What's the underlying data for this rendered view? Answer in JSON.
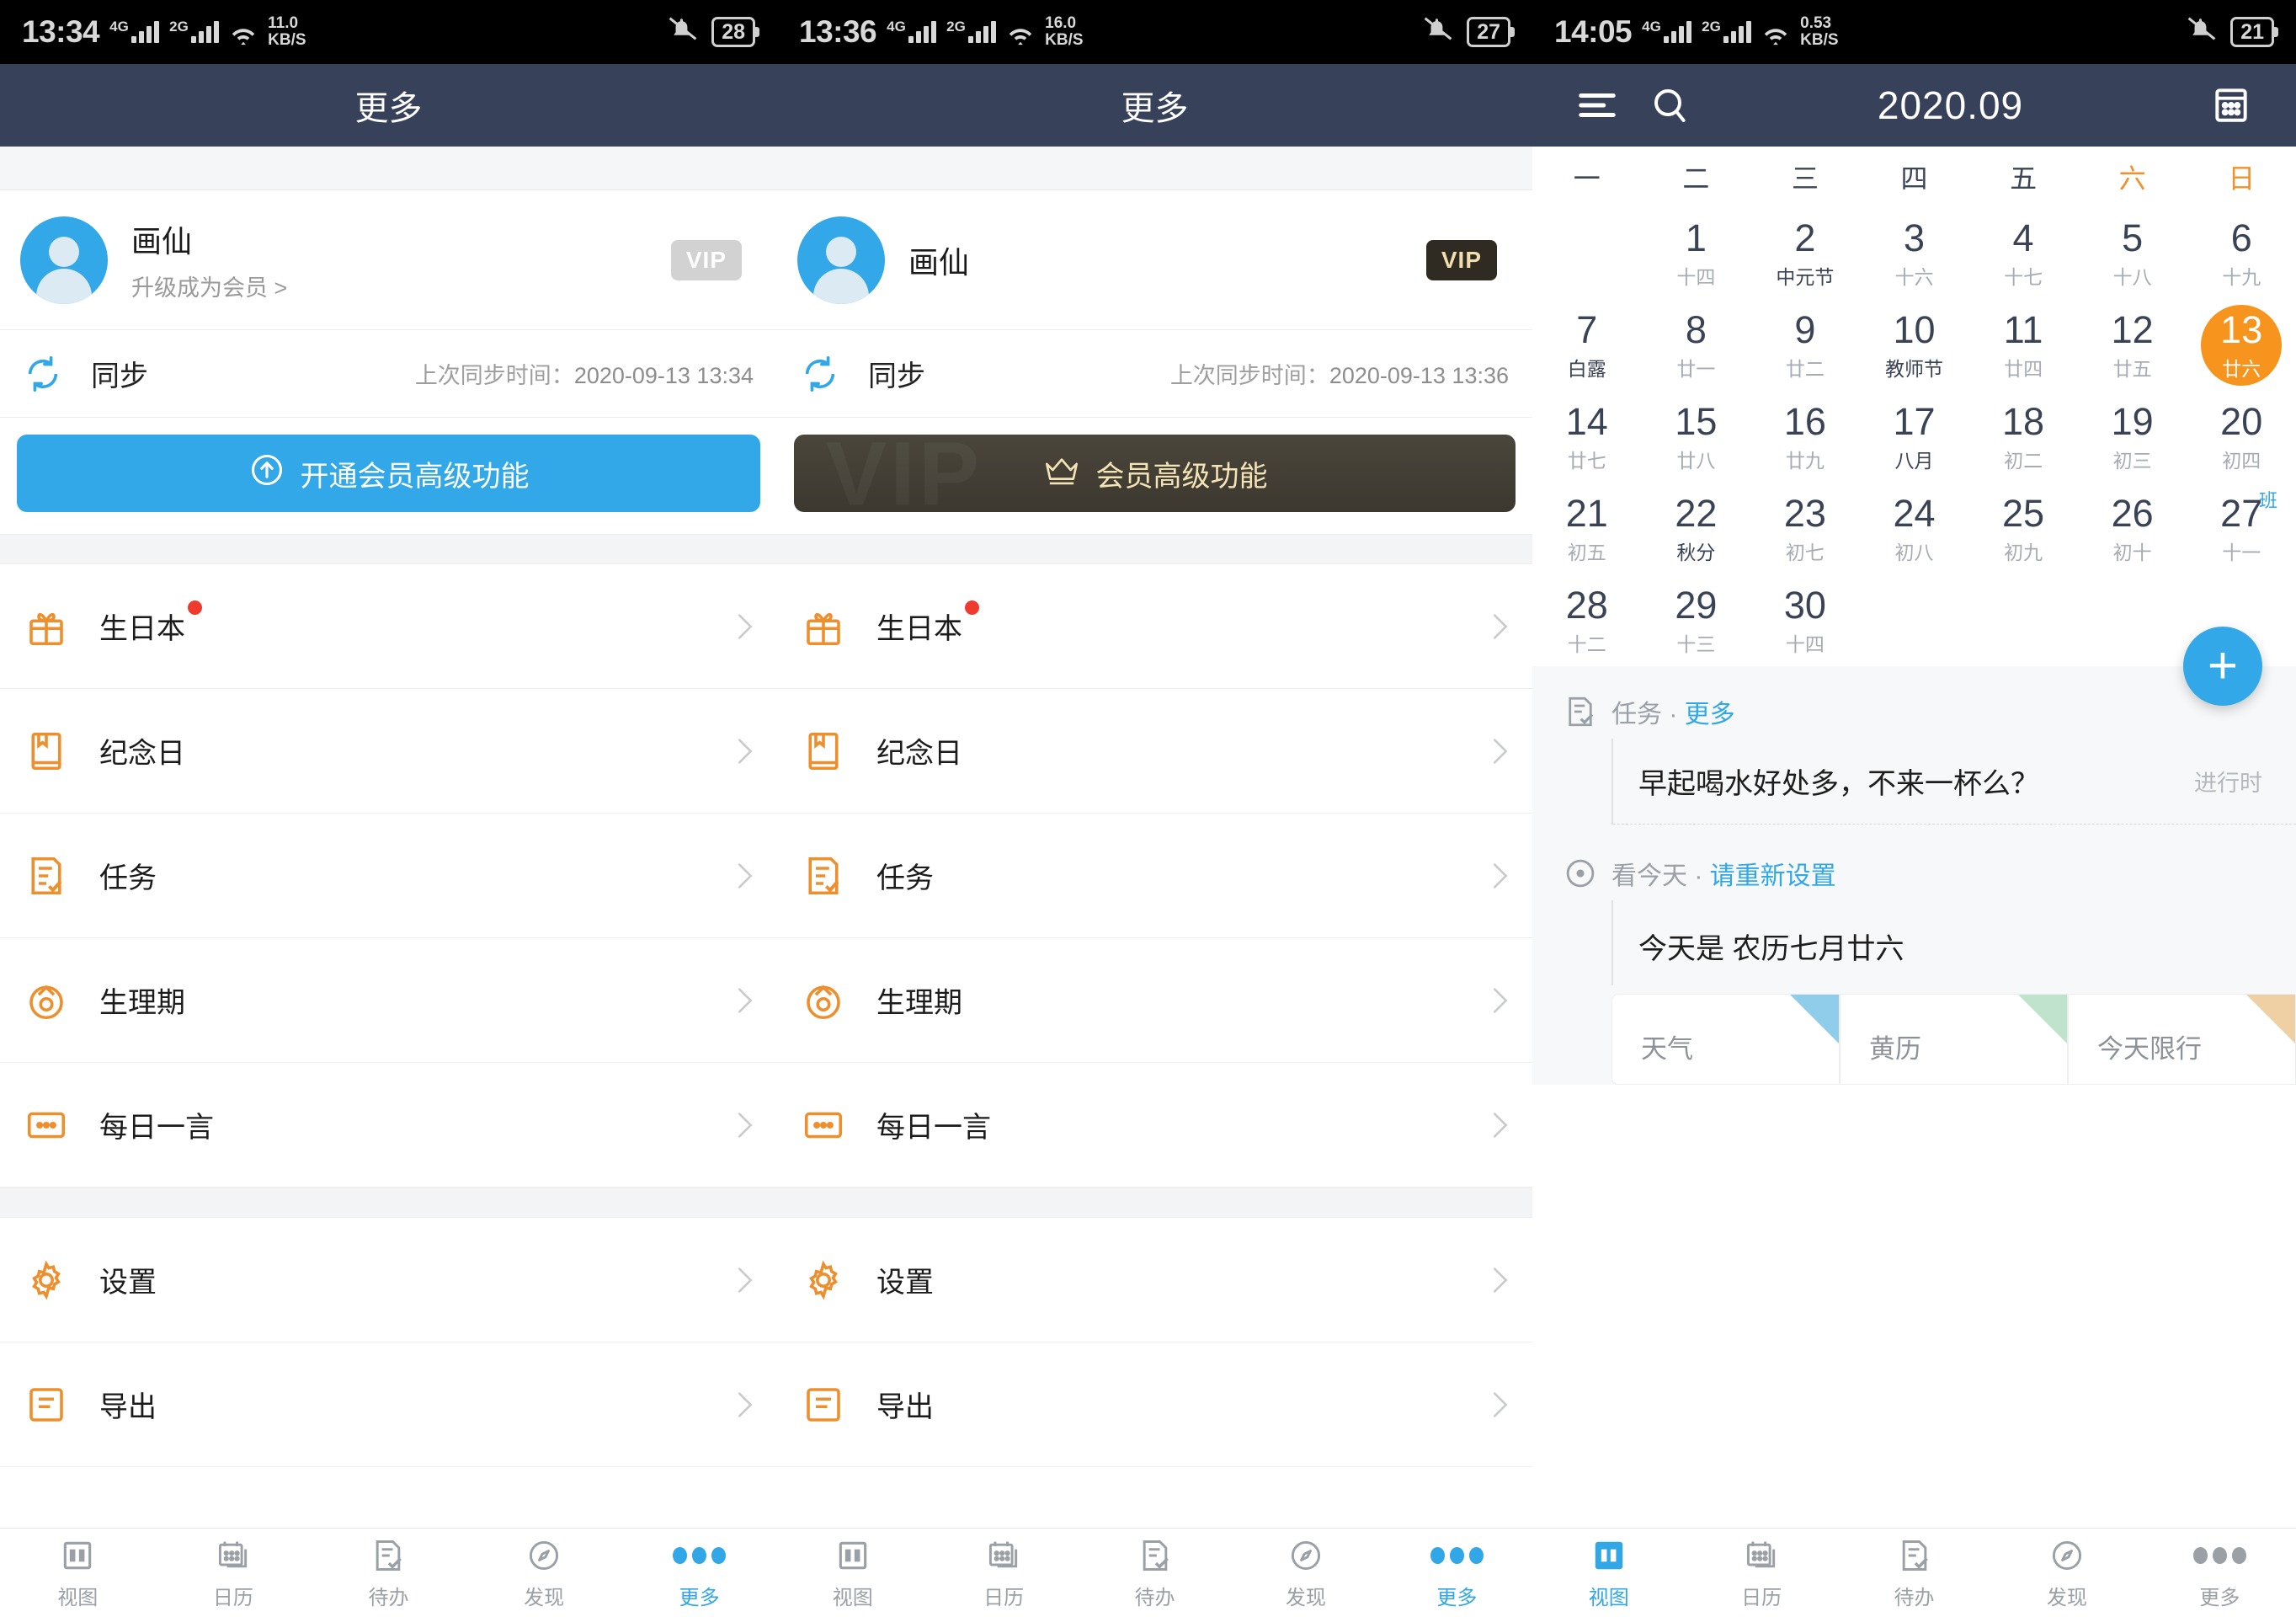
{
  "panel1": {
    "status": {
      "time": "13:34",
      "net1": "4G",
      "net2": "2G",
      "speed_value": "11.0",
      "speed_unit": "KB/S",
      "battery": "28"
    },
    "header": {
      "title": "更多"
    },
    "profile": {
      "name": "画仙",
      "subtitle": "升级成为会员 >",
      "vip_label": "VIP"
    },
    "sync": {
      "label": "同步",
      "last_label": "上次同步时间：",
      "last_value": "2020-09-13 13:34"
    },
    "vip_button": {
      "label": "开通会员高级功能",
      "icon": "upgrade-arrow-icon"
    },
    "menu": [
      {
        "label": "生日本",
        "icon": "gift-icon",
        "badge": true
      },
      {
        "label": "纪念日",
        "icon": "book-icon",
        "badge": false
      },
      {
        "label": "任务",
        "icon": "task-check-icon",
        "badge": false
      },
      {
        "label": "生理期",
        "icon": "period-icon",
        "badge": false
      },
      {
        "label": "每日一言",
        "icon": "quote-icon",
        "badge": false
      }
    ],
    "menu2": [
      {
        "label": "设置",
        "icon": "gear-icon"
      },
      {
        "label": "导出",
        "icon": "export-icon"
      }
    ]
  },
  "panel2": {
    "status": {
      "time": "13:36",
      "net1": "4G",
      "net2": "2G",
      "speed_value": "16.0",
      "speed_unit": "KB/S",
      "battery": "27"
    },
    "header": {
      "title": "更多"
    },
    "profile": {
      "name": "画仙",
      "vip_label": "VIP"
    },
    "sync": {
      "label": "同步",
      "last_label": "上次同步时间：",
      "last_value": "2020-09-13 13:36"
    },
    "vip_button": {
      "label": "会员高级功能",
      "icon": "crown-icon",
      "watermark": "VIP"
    },
    "menu": [
      {
        "label": "生日本",
        "icon": "gift-icon",
        "badge": true
      },
      {
        "label": "纪念日",
        "icon": "book-icon",
        "badge": false
      },
      {
        "label": "任务",
        "icon": "task-check-icon",
        "badge": false
      },
      {
        "label": "生理期",
        "icon": "period-icon",
        "badge": false
      },
      {
        "label": "每日一言",
        "icon": "quote-icon",
        "badge": false
      }
    ],
    "menu2": [
      {
        "label": "设置",
        "icon": "gear-icon"
      },
      {
        "label": "导出",
        "icon": "export-icon"
      }
    ]
  },
  "panel3": {
    "status": {
      "time": "14:05",
      "net1": "4G",
      "net2": "2G",
      "speed_value": "0.53",
      "speed_unit": "KB/S",
      "battery": "21"
    },
    "header": {
      "menu_icon": "hamburger-icon",
      "search_icon": "search-icon",
      "title": "2020.09",
      "calendar_icon": "calendar-grid-icon"
    },
    "weekdays": [
      "一",
      "二",
      "三",
      "四",
      "五",
      "六",
      "日"
    ],
    "calendar": {
      "lead_blanks": 1,
      "days": [
        {
          "d": "1",
          "l": "十四",
          "fest": false
        },
        {
          "d": "2",
          "l": "中元节",
          "fest": true
        },
        {
          "d": "3",
          "l": "十六",
          "fest": false
        },
        {
          "d": "4",
          "l": "十七",
          "fest": false
        },
        {
          "d": "5",
          "l": "十八",
          "fest": false
        },
        {
          "d": "6",
          "l": "十九",
          "fest": false
        },
        {
          "d": "7",
          "l": "白露",
          "fest": true
        },
        {
          "d": "8",
          "l": "廿一",
          "fest": false
        },
        {
          "d": "9",
          "l": "廿二",
          "fest": false
        },
        {
          "d": "10",
          "l": "教师节",
          "fest": true
        },
        {
          "d": "11",
          "l": "廿四",
          "fest": false
        },
        {
          "d": "12",
          "l": "廿五",
          "fest": false
        },
        {
          "d": "13",
          "l": "廿六",
          "fest": false,
          "today": true
        },
        {
          "d": "14",
          "l": "廿七",
          "fest": false
        },
        {
          "d": "15",
          "l": "廿八",
          "fest": false
        },
        {
          "d": "16",
          "l": "廿九",
          "fest": false
        },
        {
          "d": "17",
          "l": "八月",
          "fest": true
        },
        {
          "d": "18",
          "l": "初二",
          "fest": false
        },
        {
          "d": "19",
          "l": "初三",
          "fest": false
        },
        {
          "d": "20",
          "l": "初四",
          "fest": false
        },
        {
          "d": "21",
          "l": "初五",
          "fest": false
        },
        {
          "d": "22",
          "l": "秋分",
          "fest": true
        },
        {
          "d": "23",
          "l": "初七",
          "fest": false
        },
        {
          "d": "24",
          "l": "初八",
          "fest": false
        },
        {
          "d": "25",
          "l": "初九",
          "fest": false
        },
        {
          "d": "26",
          "l": "初十",
          "fest": false
        },
        {
          "d": "27",
          "l": "十一",
          "fest": false,
          "tag": "班"
        },
        {
          "d": "28",
          "l": "十二",
          "fest": false
        },
        {
          "d": "29",
          "l": "十三",
          "fest": false
        },
        {
          "d": "30",
          "l": "十四",
          "fest": false
        }
      ]
    },
    "fab_label": "+",
    "sections": {
      "task": {
        "icon": "task-check-icon",
        "title": "任务",
        "sep": " · ",
        "link": "更多",
        "item_title": "早起喝水好处多，不来一杯么？",
        "item_status": "进行时"
      },
      "today": {
        "icon": "target-dot-icon",
        "title": "看今天",
        "sep": " · ",
        "link": "请重新设置",
        "line": "今天是 农历七月廿六"
      }
    },
    "cards": [
      {
        "label": "天气",
        "color": "#8fcdeb"
      },
      {
        "label": "黄历",
        "color": "#bfe3cd"
      },
      {
        "label": "今天限行",
        "color": "#efcfa4"
      }
    ]
  },
  "bottom_nav": {
    "items": [
      {
        "label": "视图",
        "icon": "layout-view-icon"
      },
      {
        "label": "日历",
        "icon": "calendar-icon"
      },
      {
        "label": "待办",
        "icon": "todo-check-icon"
      },
      {
        "label": "发现",
        "icon": "compass-icon"
      },
      {
        "label": "更多",
        "icon": "more-dots-icon"
      }
    ],
    "active_index_panels12": 4,
    "active_index_panel3": 0
  },
  "colors": {
    "accent_blue": "#31a7e7",
    "accent_orange": "#f0922b",
    "header_navy": "#37415a",
    "today_orange": "#f7941d"
  }
}
